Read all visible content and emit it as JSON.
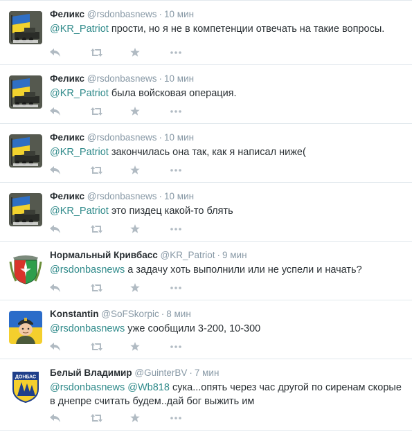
{
  "tweets": [
    {
      "fullname": "Феликс",
      "username": "@rsdonbasnews",
      "dot": "·",
      "time": "10 мин",
      "mentions": [
        "@KR_Patriot"
      ],
      "text": " прости, но я не в компетенции отвечать на такие вопросы.",
      "avatar": "flag-tank-avatar"
    },
    {
      "fullname": "Феликс",
      "username": "@rsdonbasnews",
      "dot": "·",
      "time": "10 мин",
      "mentions": [
        "@KR_Patriot"
      ],
      "text": " была войсковая операция.",
      "avatar": "flag-tank-avatar"
    },
    {
      "fullname": "Феликс",
      "username": "@rsdonbasnews",
      "dot": "·",
      "time": "10 мин",
      "mentions": [
        "@KR_Patriot"
      ],
      "text": " закончилась она так, как я написал ниже(",
      "avatar": "flag-tank-avatar"
    },
    {
      "fullname": "Феликс",
      "username": "@rsdonbasnews",
      "dot": "·",
      "time": "10 мин",
      "mentions": [
        "@KR_Patriot"
      ],
      "text": " это пиздец какой-то блять",
      "avatar": "flag-tank-avatar"
    },
    {
      "fullname": "Нормальный Кривбасс",
      "username": "@KR_Patriot",
      "dot": "·",
      "time": "9 мин",
      "mentions": [
        "@rsdonbasnews"
      ],
      "text": " а задачу хоть выполнили или не успели и начать?",
      "avatar": "coat-of-arms-avatar"
    },
    {
      "fullname": "Konstantin",
      "username": "@SoFSkorpic",
      "dot": "·",
      "time": "8 мин",
      "mentions": [
        "@rsdonbasnews"
      ],
      "text": " уже сообщили 3-200, 10-300",
      "avatar": "soldier-avatar"
    },
    {
      "fullname": "Белый Владимир",
      "username": "@GuinterBV",
      "dot": "·",
      "time": "7 мин",
      "mentions": [
        "@rsdonbasnews",
        "@Wb818"
      ],
      "text": " сука...опять через час другой по сиренам скорые в днепре считать будем..дай бог выжить им",
      "avatar": "donbas-badge-avatar",
      "badge_text": "ДОНБАС"
    }
  ],
  "icons": [
    "reply-icon",
    "retweet-icon",
    "favorite-icon",
    "more-icon"
  ],
  "colors": {
    "mention": "#2f8a8a",
    "muted": "#8899a6",
    "border": "#e1e8ed",
    "icon": "#b1bbc3"
  }
}
